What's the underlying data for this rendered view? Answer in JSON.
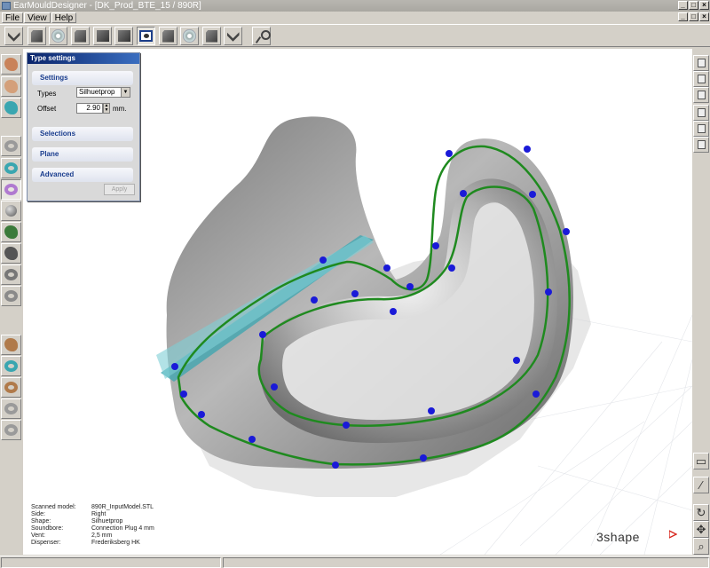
{
  "window": {
    "title": "EarMouldDesigner - [DK_Prod_BTE_15 / 890R]"
  },
  "menu": [
    "File",
    "View",
    "Help"
  ],
  "toolbar": {
    "buttons": [
      "arrow-down-icon",
      "document-icon",
      "disc-icon",
      "document-icon",
      "square-icon",
      "square-icon",
      "screen-icon",
      "document-icon",
      "disc-icon",
      "document-icon",
      "arrow-down-icon",
      "measure-tool-icon"
    ],
    "active_index": 6
  },
  "left_toolbar": {
    "group1": [
      "ear-icon",
      "ear-icon",
      "ear-icon",
      "ring-icon",
      "ring-icon",
      "ring-icon",
      "ball-icon",
      "bucket-icon",
      "brush-icon",
      "ring-icon",
      "ring-icon"
    ],
    "group2": [
      "pencil-icon",
      "ring-icon",
      "ring-icon",
      "ring-icon",
      "ring-icon"
    ],
    "active_index": 5
  },
  "panel": {
    "title": "Type settings",
    "settings_header": "Settings",
    "types_label": "Types",
    "types_value": "Silhuetprop",
    "offset_label": "Offset",
    "offset_value": "2.90",
    "offset_unit": "mm.",
    "selections_header": "Selections",
    "plane_header": "Plane",
    "advanced_header": "Advanced",
    "apply_label": "Apply"
  },
  "model_info": [
    {
      "key": "Scanned model:",
      "value": "890R_InputModel.STL"
    },
    {
      "key": "Side:",
      "value": "Right"
    },
    {
      "key": "Shape:",
      "value": "Silhuetprop"
    },
    {
      "key": "Soundbore:",
      "value": "Connection Plug 4 mm"
    },
    {
      "key": "Vent:",
      "value": "2,5 mm"
    },
    {
      "key": "Dispenser:",
      "value": "Frederiksberg HK"
    }
  ],
  "logo": "3shape",
  "colors": {
    "curve": "#1f8a1f",
    "control_point": "#1a1ad8",
    "plane": "#3aa6b0",
    "model": "#8c8c8c",
    "title_active": "#0a246a"
  }
}
